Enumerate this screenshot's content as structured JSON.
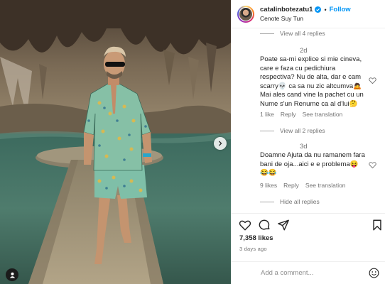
{
  "post": {
    "username": "catalinbotezatu1",
    "follow_label": "Follow",
    "location": "Cenote Suy Tun",
    "likes": "7,358 likes",
    "time_ago": "3 days ago",
    "add_comment_placeholder": "Add a comment..."
  },
  "thread": {
    "view_all_top": "View all 4 replies",
    "comments": [
      {
        "time": "2d",
        "lines": [
          "Poate sa-mi explice si mie cineva,",
          "care e faza cu pedichiura",
          "respectiva? Nu de alta, dar e cam",
          "scarry💀 ca sa nu zic altcumva🙇",
          "Mai ales cand vine la pachet cu un",
          "Nume s'un Renume ca al d'lui🤔"
        ],
        "likes": "1 like",
        "reply": "Reply",
        "translate": "See translation",
        "replies": "View all 2 replies"
      },
      {
        "time": "3d",
        "lines": [
          "Doamne Ajuta da nu ramanem fara",
          "bani de oja...aici e e problema😝",
          "😂😂"
        ],
        "likes": "9 likes",
        "reply": "Reply",
        "translate": "See translation",
        "replies": "Hide all replies"
      }
    ]
  },
  "colors": {
    "accent": "#0095f6",
    "muted": "#737373",
    "text": "#262626"
  },
  "icons": [
    "verified-badge-icon",
    "heart-icon",
    "comment-icon",
    "share-icon",
    "bookmark-icon",
    "emoji-icon",
    "chevron-right-icon",
    "user-tag-icon"
  ]
}
